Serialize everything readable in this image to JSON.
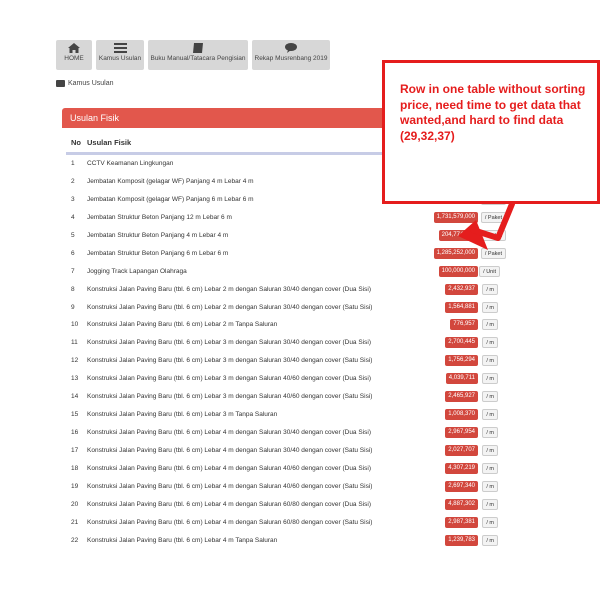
{
  "nav": {
    "items": [
      {
        "label": "HOME",
        "icon": "home-icon"
      },
      {
        "label": "Kamus Usulan",
        "icon": "list-icon"
      },
      {
        "label": "Buku Manual/Tatacara Pengisian",
        "icon": "book-icon"
      },
      {
        "label": "Rekap Musrenbang 2019",
        "icon": "chat-icon"
      }
    ]
  },
  "breadcrumb": {
    "label": "Kamus Usulan"
  },
  "panel": {
    "title": "Usulan Fisik",
    "columns": {
      "no": "No",
      "name": "Usulan Fisik"
    }
  },
  "rows": [
    {
      "no": "1",
      "name": "CCTV Keamanan Lingkungan",
      "price": "",
      "unit": ""
    },
    {
      "no": "2",
      "name": "Jembatan Komposit (gelagar WF) Panjang 4 m Lebar 4 m",
      "price": "",
      "unit": ""
    },
    {
      "no": "3",
      "name": "Jembatan Komposit (gelagar WF) Panjang 6 m Lebar 6 m",
      "price": "",
      "unit": "/ Paket"
    },
    {
      "no": "4",
      "name": "Jembatan Struktur Beton Panjang 12 m Lebar 6 m",
      "price": "1,731,579,000",
      "unit": "/ Paket"
    },
    {
      "no": "5",
      "name": "Jembatan Struktur Beton Panjang 4 m Lebar 4 m",
      "price": "204,774,000",
      "unit": "/ Paket"
    },
    {
      "no": "6",
      "name": "Jembatan Struktur Beton Panjang 6 m Lebar 6 m",
      "price": "1,285,252,000",
      "unit": "/ Paket"
    },
    {
      "no": "7",
      "name": "Jogging Track Lapangan Olahraga",
      "price": "100,000,000",
      "unit": "/ Unit"
    },
    {
      "no": "8",
      "name": "Konstruksi Jalan Paving Baru (tbl. 6 cm) Lebar 2 m dengan Saluran 30/40 dengan cover (Dua Sisi)",
      "price": "2,432,937",
      "unit": "/ m"
    },
    {
      "no": "9",
      "name": "Konstruksi Jalan Paving Baru (tbl. 6 cm) Lebar 2 m dengan Saluran 30/40 dengan cover (Satu Sisi)",
      "price": "1,564,881",
      "unit": "/ m"
    },
    {
      "no": "10",
      "name": "Konstruksi Jalan Paving Baru (tbl. 6 cm) Lebar 2 m Tanpa Saluran",
      "price": "776,957",
      "unit": "/ m"
    },
    {
      "no": "11",
      "name": "Konstruksi Jalan Paving Baru (tbl. 6 cm) Lebar 3 m dengan Saluran 30/40 dengan cover (Dua Sisi)",
      "price": "2,700,445",
      "unit": "/ m"
    },
    {
      "no": "12",
      "name": "Konstruksi Jalan Paving Baru (tbl. 6 cm) Lebar 3 m dengan Saluran 30/40 dengan cover (Satu Sisi)",
      "price": "1,756,294",
      "unit": "/ m"
    },
    {
      "no": "13",
      "name": "Konstruksi Jalan Paving Baru (tbl. 6 cm) Lebar 3 m dengan Saluran 40/60 dengan cover (Dua Sisi)",
      "price": "4,039,711",
      "unit": "/ m"
    },
    {
      "no": "14",
      "name": "Konstruksi Jalan Paving Baru (tbl. 6 cm) Lebar 3 m dengan Saluran 40/60 dengan cover (Satu Sisi)",
      "price": "2,465,927",
      "unit": "/ m"
    },
    {
      "no": "15",
      "name": "Konstruksi Jalan Paving Baru (tbl. 6 cm) Lebar 3 m Tanpa Saluran",
      "price": "1,008,370",
      "unit": "/ m"
    },
    {
      "no": "16",
      "name": "Konstruksi Jalan Paving Baru (tbl. 6 cm) Lebar 4 m dengan Saluran 30/40 dengan cover (Dua Sisi)",
      "price": "2,967,954",
      "unit": "/ m"
    },
    {
      "no": "17",
      "name": "Konstruksi Jalan Paving Baru (tbl. 6 cm) Lebar 4 m dengan Saluran 30/40 dengan cover (Satu Sisi)",
      "price": "2,027,707",
      "unit": "/ m"
    },
    {
      "no": "18",
      "name": "Konstruksi Jalan Paving Baru (tbl. 6 cm) Lebar 4 m dengan Saluran 40/60 dengan cover (Dua Sisi)",
      "price": "4,307,219",
      "unit": "/ m"
    },
    {
      "no": "19",
      "name": "Konstruksi Jalan Paving Baru (tbl. 6 cm) Lebar 4 m dengan Saluran 40/60 dengan cover (Satu Sisi)",
      "price": "2,697,340",
      "unit": "/ m"
    },
    {
      "no": "20",
      "name": "Konstruksi Jalan Paving Baru (tbl. 6 cm) Lebar 4 m dengan Saluran 60/80 dengan cover (Dua Sisi)",
      "price": "4,887,302",
      "unit": "/ m"
    },
    {
      "no": "21",
      "name": "Konstruksi Jalan Paving Baru (tbl. 6 cm) Lebar 4 m dengan Saluran 60/80 dengan cover (Satu Sisi)",
      "price": "2,987,381",
      "unit": "/ m"
    },
    {
      "no": "22",
      "name": "Konstruksi Jalan Paving Baru (tbl. 6 cm) Lebar 4 m Tanpa Saluran",
      "price": "1,239,783",
      "unit": "/ m"
    }
  ],
  "annotation": {
    "text": "Row in one table without sorting price, need time to get data that wanted,and hard to find data (29,32,37)",
    "color": "#e51d1d"
  },
  "colors": {
    "header": "#e2574c",
    "price_badge": "#d2473d",
    "nav": "#d7d7d7"
  }
}
